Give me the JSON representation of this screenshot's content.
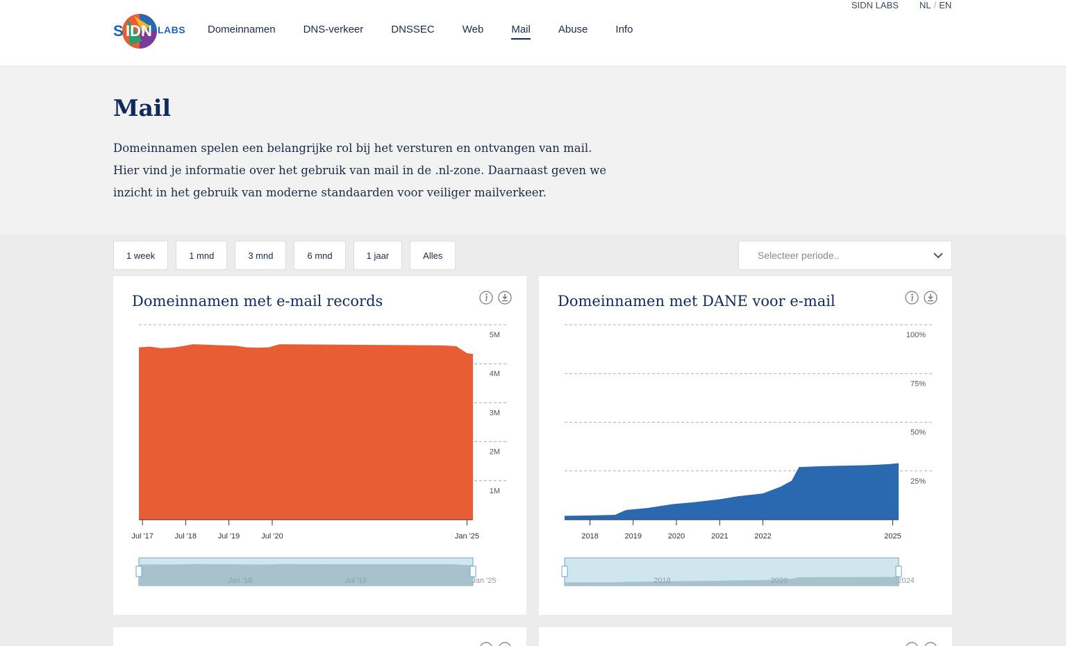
{
  "header": {
    "utility_link": "SIDN LABS",
    "lang_nl": "NL",
    "lang_sep": "/",
    "lang_en": "EN",
    "logo_text": "LABS",
    "nav": [
      {
        "label": "Domeinnamen"
      },
      {
        "label": "DNS-verkeer"
      },
      {
        "label": "DNSSEC"
      },
      {
        "label": "Web"
      },
      {
        "label": "Mail",
        "active": true
      },
      {
        "label": "Abuse"
      },
      {
        "label": "Info"
      }
    ]
  },
  "hero": {
    "title": "Mail",
    "intro": "Domeinnamen spelen een belangrijke rol bij het versturen en ontvangen van mail. Hier vind je informatie over het gebruik van mail in de .nl-zone. Daarnaast geven we inzicht in het gebruik van moderne standaarden voor veiliger mailverkeer."
  },
  "filters": {
    "ranges": [
      "1 week",
      "1 mnd",
      "3 mnd",
      "6 mnd",
      "1 jaar",
      "Alles"
    ],
    "period_placeholder": "Selecteer periode.."
  },
  "colors": {
    "accent_orange": "#e85d33",
    "accent_blue": "#2a69b0",
    "navy": "#0f2a5c",
    "navigator": "#a8c8d6"
  },
  "icons": [
    "info-icon",
    "download-icon",
    "chevron-down-icon"
  ],
  "cards": [
    {
      "title": "Domeinnamen met e-mail records"
    },
    {
      "title": "Domeinnamen met DANE voor e-mail"
    }
  ],
  "chart_data": [
    {
      "type": "area",
      "title": "Domeinnamen met e-mail records",
      "color": "#e85d33",
      "ylim": [
        0,
        5000000
      ],
      "yticks": [
        {
          "v": 1000000,
          "label": "1M"
        },
        {
          "v": 2000000,
          "label": "2M"
        },
        {
          "v": 3000000,
          "label": "3M"
        },
        {
          "v": 4000000,
          "label": "4M"
        },
        {
          "v": 5000000,
          "label": "5M"
        }
      ],
      "xlim": [
        "2017-06-01",
        "2025-02-20"
      ],
      "xticks": [
        {
          "d": "2017-07-01",
          "label": "Jul '17"
        },
        {
          "d": "2018-07-01",
          "label": "Jul '18"
        },
        {
          "d": "2019-07-01",
          "label": "Jul '19"
        },
        {
          "d": "2020-07-01",
          "label": "Jul '20"
        },
        {
          "d": "2025-01-01",
          "label": "Jan '25"
        }
      ],
      "navigator_labels": [
        "Jan '18",
        "Jul '19",
        "Jan '25"
      ],
      "x": [
        "2017-06-01",
        "2017-09-01",
        "2017-12-01",
        "2018-03-01",
        "2018-06-01",
        "2018-09-01",
        "2018-12-01",
        "2019-03-01",
        "2019-06-01",
        "2019-09-01",
        "2019-12-01",
        "2020-03-01",
        "2020-06-01",
        "2020-09-01",
        "2024-06-01",
        "2024-10-01",
        "2025-01-01",
        "2025-02-20"
      ],
      "y": [
        4420000,
        4440000,
        4400000,
        4410000,
        4450000,
        4500000,
        4490000,
        4480000,
        4470000,
        4460000,
        4420000,
        4410000,
        4420000,
        4500000,
        4470000,
        4450000,
        4270000,
        4250000
      ],
      "grid": true,
      "yaxis_position": "right"
    },
    {
      "type": "area",
      "title": "Domeinnamen met DANE voor e-mail",
      "color": "#2a69b0",
      "ylim": [
        0,
        100
      ],
      "yticks": [
        {
          "v": 25,
          "label": "25%"
        },
        {
          "v": 50,
          "label": "50%"
        },
        {
          "v": 75,
          "label": "75%"
        },
        {
          "v": 100,
          "label": "100%"
        }
      ],
      "xlim": [
        "2017-06-01",
        "2025-02-20"
      ],
      "xticks": [
        {
          "d": "2018-01-01",
          "label": "2018"
        },
        {
          "d": "2019-01-01",
          "label": "2019"
        },
        {
          "d": "2020-01-01",
          "label": "2020"
        },
        {
          "d": "2021-01-01",
          "label": "2021"
        },
        {
          "d": "2022-01-01",
          "label": "2022"
        },
        {
          "d": "2025-01-01",
          "label": "2025"
        }
      ],
      "navigator_labels": [
        "2018",
        "2020",
        "2024"
      ],
      "x": [
        "2017-06-01",
        "2018-01-01",
        "2018-08-01",
        "2018-11-01",
        "2019-05-01",
        "2019-12-01",
        "2020-06-01",
        "2021-01-01",
        "2021-06-01",
        "2022-01-01",
        "2022-06-01",
        "2022-09-01",
        "2022-11-01",
        "2023-06-01",
        "2024-06-01",
        "2024-12-01",
        "2025-02-20"
      ],
      "y": [
        2,
        2.2,
        2.5,
        5,
        6,
        8,
        9,
        10.5,
        12,
        13.5,
        17,
        20,
        27,
        27.5,
        28,
        28.5,
        29
      ],
      "grid": true,
      "yaxis_position": "right"
    }
  ]
}
